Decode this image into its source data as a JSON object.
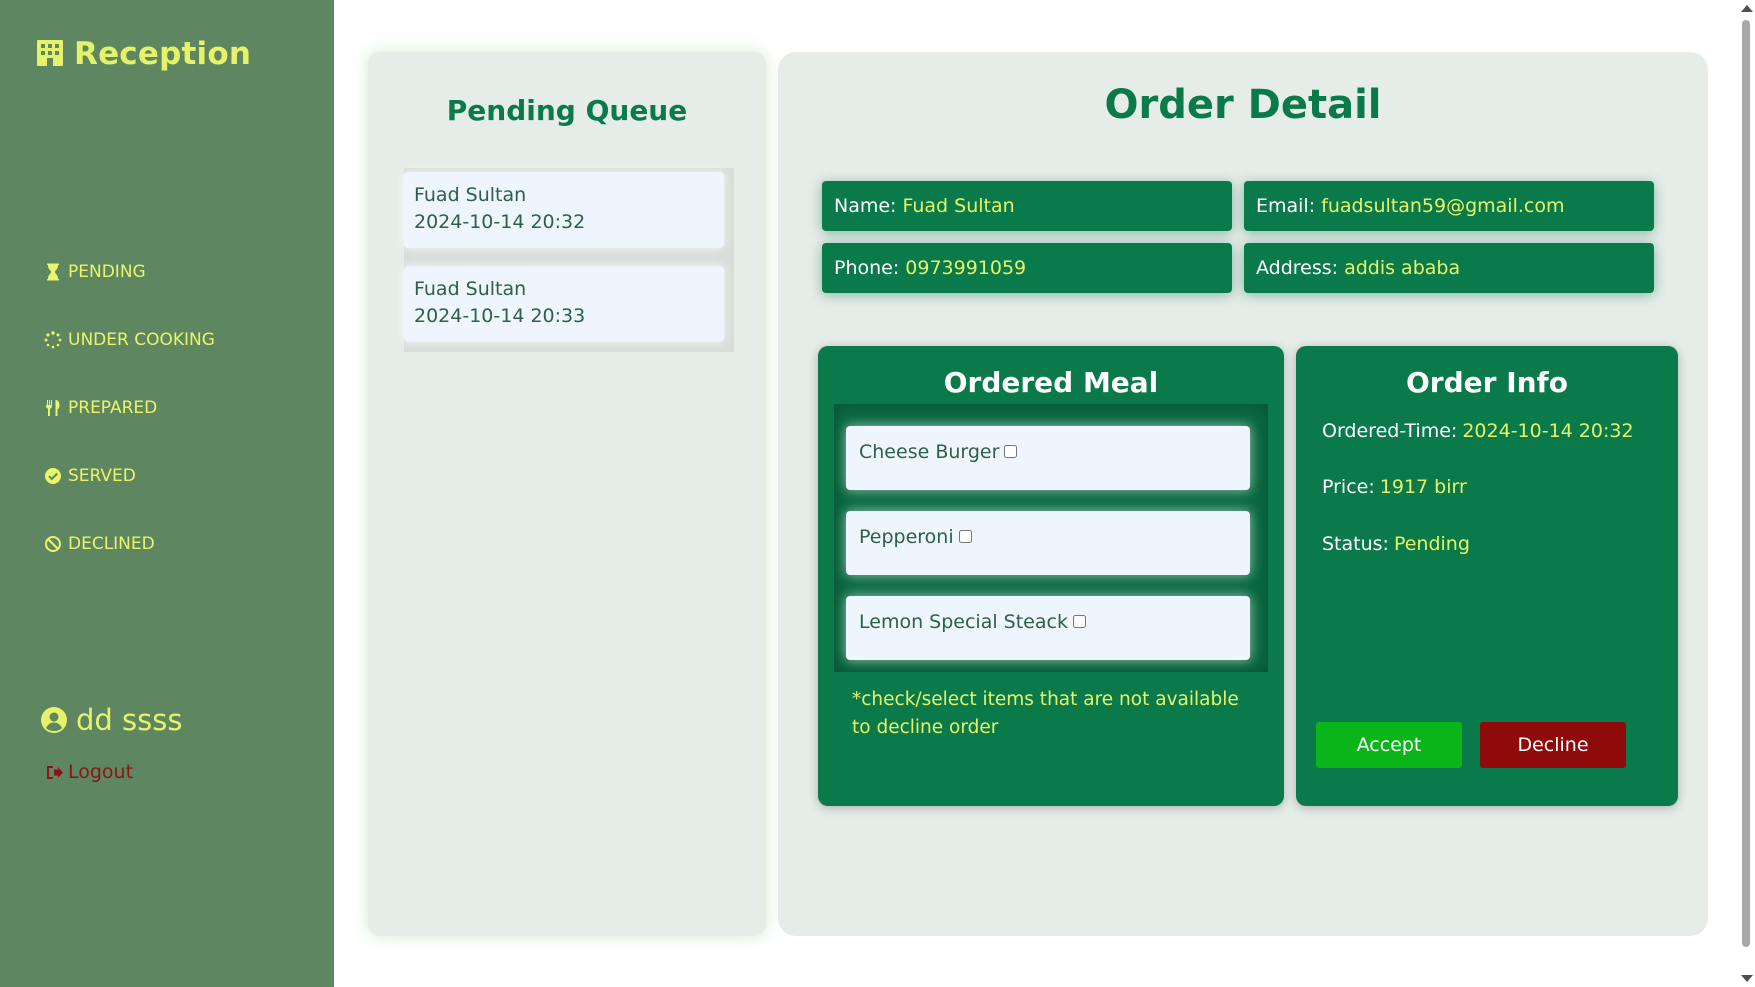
{
  "sidebar": {
    "brand": "Reception",
    "nav": [
      {
        "label": "PENDING",
        "icon": "hourglass-icon"
      },
      {
        "label": "UNDER COOKING",
        "icon": "spinner-icon"
      },
      {
        "label": "PREPARED",
        "icon": "utensils-icon"
      },
      {
        "label": "SERVED",
        "icon": "check-circle-icon"
      },
      {
        "label": "DECLINED",
        "icon": "ban-icon"
      }
    ],
    "user_name": "dd ssss",
    "logout_label": "Logout"
  },
  "queue": {
    "title": "Pending Queue",
    "items": [
      {
        "name": "Fuad Sultan",
        "time": "2024-10-14 20:32"
      },
      {
        "name": "Fuad Sultan",
        "time": "2024-10-14 20:33"
      }
    ]
  },
  "detail": {
    "title": "Order Detail",
    "name_label": "Name:",
    "name_value": "Fuad Sultan",
    "email_label": "Email:",
    "email_value": "fuadsultan59@gmail.com",
    "phone_label": "Phone:",
    "phone_value": "0973991059",
    "address_label": "Address:",
    "address_value": "addis ababa"
  },
  "meal": {
    "title": "Ordered Meal",
    "items": [
      {
        "label": "Cheese Burger",
        "checked": false
      },
      {
        "label": "Pepperoni",
        "checked": false
      },
      {
        "label": "Lemon Special Steack",
        "checked": false
      }
    ],
    "note": "*check/select items that are not available to decline order"
  },
  "order_info": {
    "title": "Order Info",
    "time_label": "Ordered-Time:",
    "time_value": "2024-10-14 20:32",
    "price_label": "Price:",
    "price_value": "1917 birr",
    "status_label": "Status:",
    "status_value": "Pending",
    "accept_label": "Accept",
    "decline_label": "Decline"
  },
  "colors": {
    "sidebar_bg": "#5d8661",
    "accent_yellow": "#e6f36a",
    "primary_green": "#0b7a4b",
    "panel_bg": "#e6ece8",
    "accept": "#0ab51a",
    "decline": "#8f0a0a"
  }
}
